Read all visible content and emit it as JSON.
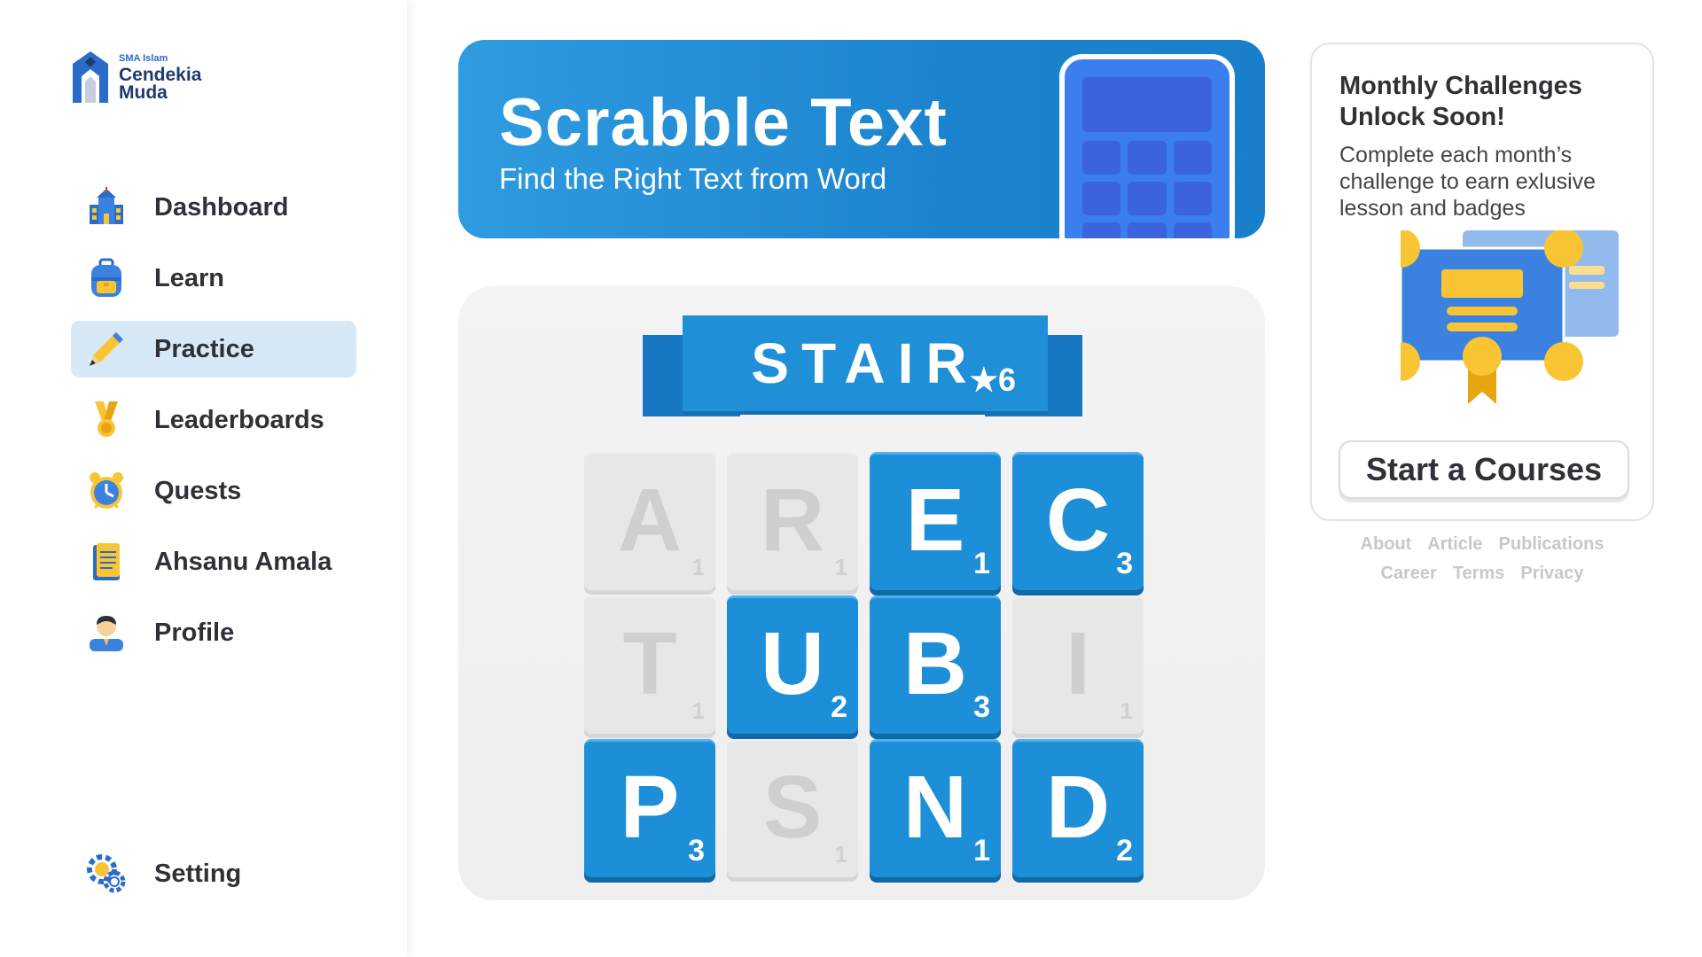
{
  "logo": {
    "small": "SMA Islam",
    "line1": "Cendekia",
    "line2": "Muda"
  },
  "nav": {
    "items": [
      {
        "label": "Dashboard",
        "icon": "school-building-icon"
      },
      {
        "label": "Learn",
        "icon": "backpack-icon"
      },
      {
        "label": "Practice",
        "icon": "pencil-icon",
        "active": true
      },
      {
        "label": "Leaderboards",
        "icon": "medal-icon"
      },
      {
        "label": "Quests",
        "icon": "alarm-clock-icon"
      },
      {
        "label": "Ahsanu Amala",
        "icon": "notebook-icon"
      },
      {
        "label": "Profile",
        "icon": "person-icon"
      }
    ],
    "setting": {
      "label": "Setting",
      "icon": "gear-icon"
    }
  },
  "banner": {
    "title": "Scrabble Text",
    "subtitle": "Find the Right Text from Word"
  },
  "game": {
    "word": "STAIR",
    "score": "★6",
    "tiles": [
      {
        "letter": "A",
        "points": "1",
        "active": false
      },
      {
        "letter": "R",
        "points": "1",
        "active": false
      },
      {
        "letter": "E",
        "points": "1",
        "active": true
      },
      {
        "letter": "C",
        "points": "3",
        "active": true
      },
      {
        "letter": "T",
        "points": "1",
        "active": false
      },
      {
        "letter": "U",
        "points": "2",
        "active": true
      },
      {
        "letter": "B",
        "points": "3",
        "active": true
      },
      {
        "letter": "I",
        "points": "1",
        "active": false
      },
      {
        "letter": "P",
        "points": "3",
        "active": true
      },
      {
        "letter": "S",
        "points": "1",
        "active": false
      },
      {
        "letter": "N",
        "points": "1",
        "active": true
      },
      {
        "letter": "D",
        "points": "2",
        "active": true
      }
    ]
  },
  "challenge": {
    "title": "Monthly Challenges Unlock Soon!",
    "description": "Complete each month’s challenge to earn exlusive lesson and badges",
    "button": "Start a Courses"
  },
  "footer": {
    "row1": [
      "About",
      "Article",
      "Publications"
    ],
    "row2": [
      "Career",
      "Terms",
      "Privacy"
    ]
  },
  "colors": {
    "primary": "#1d8fd8",
    "active_nav": "#d7e8f7",
    "accent": "#f9c534"
  }
}
